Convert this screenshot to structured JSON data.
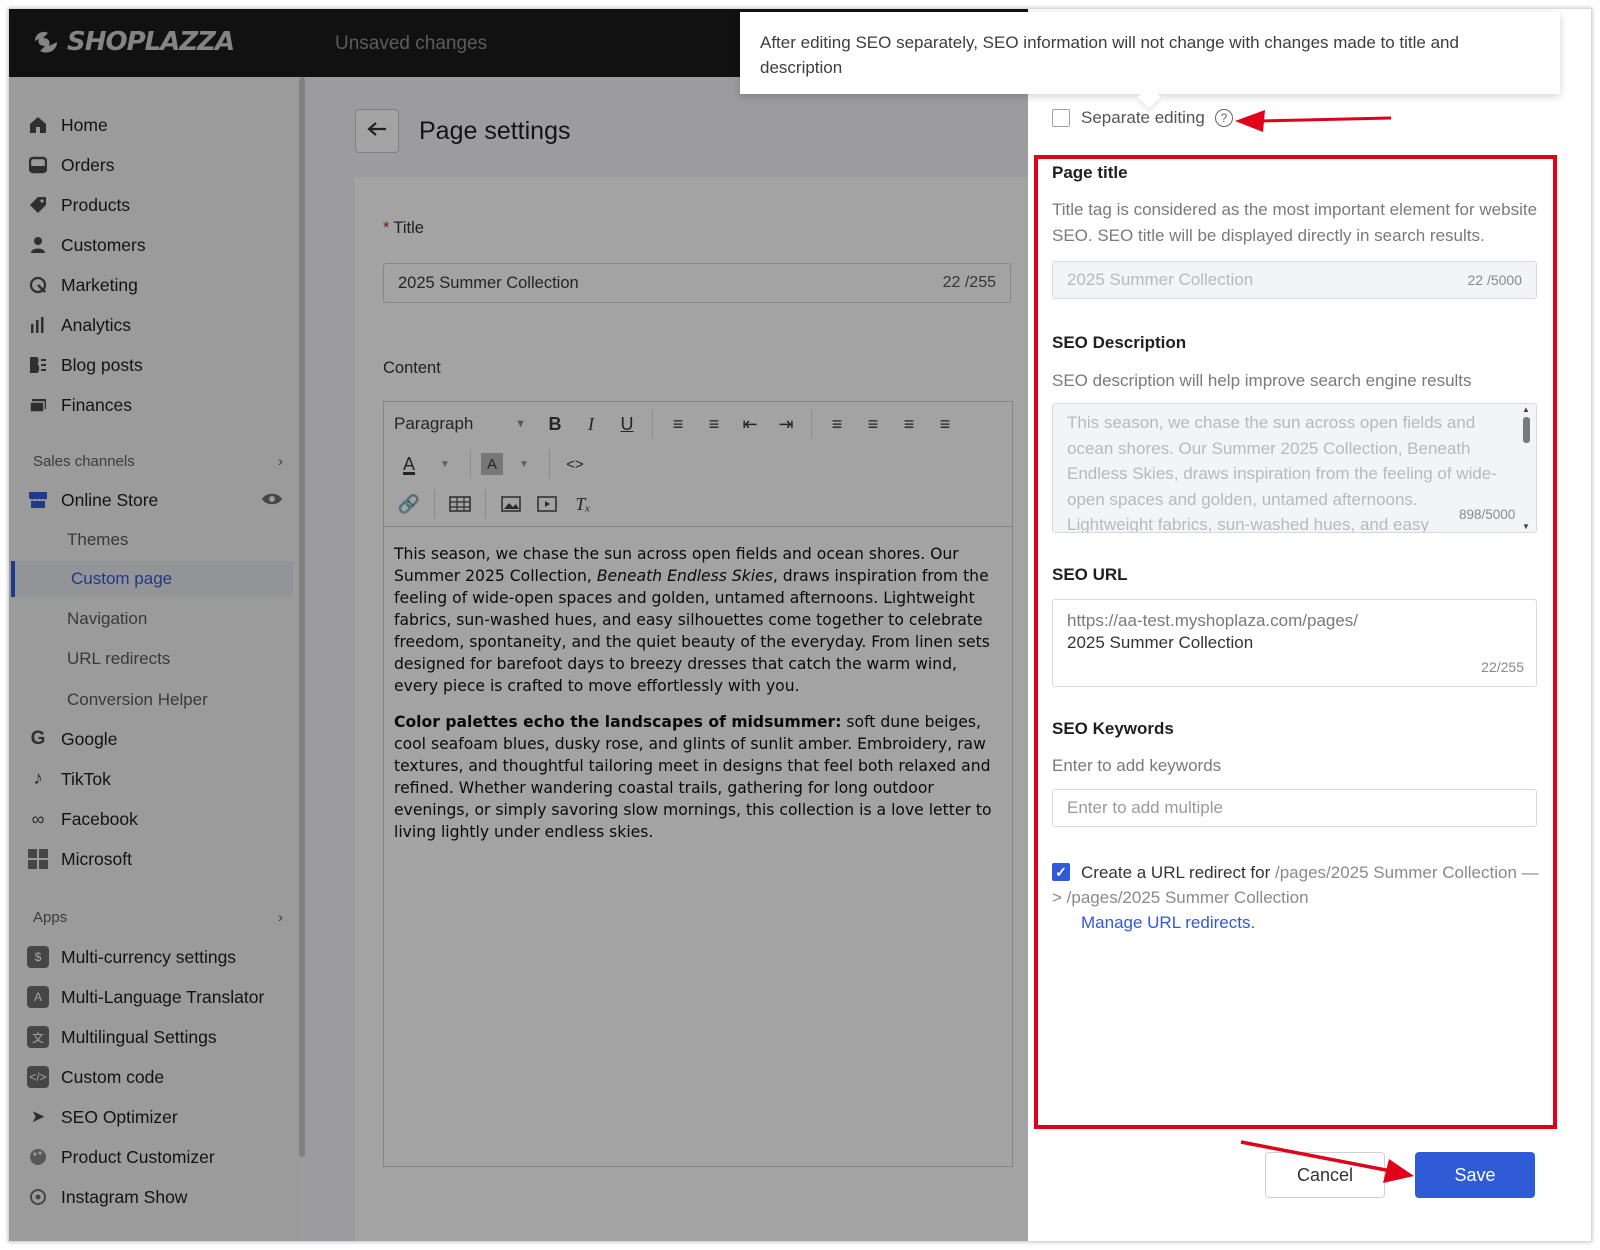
{
  "topbar": {
    "brand": "SHOPLAZZA",
    "status": "Unsaved changes"
  },
  "sidebar": {
    "items": [
      {
        "label": "Home",
        "icon": "home-icon"
      },
      {
        "label": "Orders",
        "icon": "orders-icon"
      },
      {
        "label": "Products",
        "icon": "tag-icon"
      },
      {
        "label": "Customers",
        "icon": "person-icon"
      },
      {
        "label": "Marketing",
        "icon": "marketing-icon"
      },
      {
        "label": "Analytics",
        "icon": "bar-chart-icon"
      },
      {
        "label": "Blog posts",
        "icon": "blog-icon"
      },
      {
        "label": "Finances",
        "icon": "finance-icon"
      }
    ],
    "sales_channels_label": "Sales channels",
    "online_store": "Online Store",
    "online_store_sub": [
      "Themes",
      "Custom page",
      "Navigation",
      "URL redirects",
      "Conversion Helper"
    ],
    "channels": [
      "Google",
      "TikTok",
      "Facebook",
      "Microsoft"
    ],
    "apps_label": "Apps",
    "apps": [
      "Multi-currency settings",
      "Multi-Language Translator",
      "Multilingual Settings",
      "Custom code",
      "SEO Optimizer",
      "Product Customizer",
      "Instagram Show"
    ]
  },
  "main": {
    "page_title": "Page settings",
    "title_label": "Title",
    "title_value": "2025 Summer Collection",
    "title_count": "22 /255",
    "content_label": "Content",
    "paragraph_select": "Paragraph",
    "body_p1_a": "This season, we chase the sun across open fields and ocean shores. Our Summer 2025 Collection, ",
    "body_p1_em": "Beneath Endless Skies",
    "body_p1_b": ", draws inspiration from the feeling of wide-open spaces and golden, untamed afternoons. Lightweight fabrics, sun-washed hues, and easy silhouettes come together to celebrate freedom, spontaneity, and the quiet beauty of the everyday. From linen sets designed for barefoot days to breezy dresses that catch the warm wind, every piece is crafted to move effortlessly with you.",
    "body_p2_strong": "Color palettes echo the landscapes of midsummer:",
    "body_p2_rest": " soft dune beiges, cool seafoam blues, dusky rose, and glints of sunlit amber. Embroidery, raw textures, and thoughtful tailoring meet in designs that feel both relaxed and refined. Whether wandering coastal trails, gathering for long outdoor evenings, or simply savoring slow mornings, this collection is a love letter to living lightly under endless skies."
  },
  "drawer": {
    "tooltip": "After editing SEO separately, SEO information will not change with changes made to title and description",
    "separate_editing": "Separate editing",
    "page_title_head": "Page title",
    "page_title_desc": "Title tag is considered as the most important element for website SEO. SEO title will be displayed directly in search results.",
    "page_title_value": "2025 Summer Collection",
    "page_title_count": "22 /5000",
    "seo_desc_head": "SEO Description",
    "seo_desc_desc": "SEO description will help improve search engine results",
    "seo_desc_value": "This season, we chase the sun across open fields and ocean shores. Our Summer 2025 Collection, Beneath Endless Skies, draws inspiration from the feeling of wide-open spaces and golden, untamed afternoons. Lightweight fabrics, sun-washed hues, and easy silhouettes come",
    "seo_desc_count": "898/5000",
    "seo_url_head": "SEO URL",
    "seo_url_prefix": "https://aa-test.myshoplaza.com/pages/",
    "seo_url_value": "2025 Summer Collection",
    "seo_url_count": "22/255",
    "seo_kw_head": "SEO Keywords",
    "seo_kw_desc": "Enter to add keywords",
    "seo_kw_placeholder": "Enter to add multiple",
    "redirect_text_a": "Create a URL redirect for ",
    "redirect_from": "/pages/2025 Summer Collection —",
    "redirect_to": "> /pages/2025 Summer Collection",
    "manage_link": "Manage URL redirects.",
    "cancel": "Cancel",
    "save": "Save"
  },
  "colors": {
    "accent": "#2f5bd6",
    "highlight_red": "#e0001a",
    "topbar": "#1c1c1c"
  }
}
